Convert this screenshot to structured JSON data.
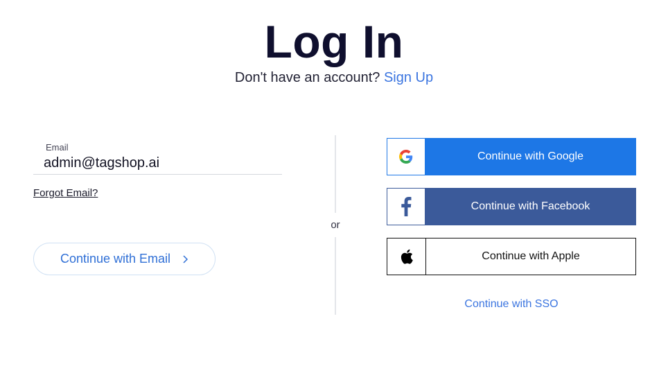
{
  "header": {
    "title": "Log In",
    "subtitle_text": "Don't have an account?",
    "signup_link": "Sign Up"
  },
  "email_form": {
    "label": "Email",
    "value": "admin@tagshop.ai",
    "forgot_link": "Forgot Email?",
    "continue_button": "Continue with Email"
  },
  "divider": {
    "text": "or"
  },
  "social": {
    "google": "Continue with Google",
    "facebook": "Continue with Facebook",
    "apple": "Continue with Apple",
    "sso": "Continue with SSO"
  },
  "colors": {
    "google_blue": "#1d77e6",
    "facebook_blue": "#3b5a9a",
    "link_blue": "#3b75e0"
  },
  "icons": [
    "google-icon",
    "facebook-icon",
    "apple-icon",
    "chevron-right-icon"
  ]
}
